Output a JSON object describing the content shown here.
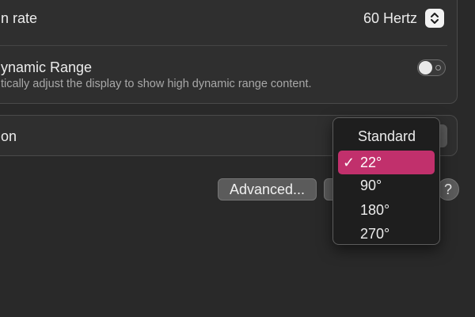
{
  "refresh": {
    "label": "n rate",
    "value": "60 Hertz"
  },
  "hdr": {
    "title": "ynamic Range",
    "description": "tically adjust the display to show high dynamic range content.",
    "enabled": false
  },
  "rotation": {
    "label": "on"
  },
  "buttons": {
    "advanced": "Advanced...",
    "help": "?"
  },
  "rotation_menu": {
    "header": "Standard",
    "check_mark": "✓",
    "selected": "22°",
    "options": [
      "22°",
      "90°",
      "180°",
      "270°"
    ]
  },
  "colors": {
    "accent": "#c1306c",
    "window_bg": "#292929",
    "card_bg": "#2f2f2f",
    "menu_bg": "#1e1e1e"
  }
}
